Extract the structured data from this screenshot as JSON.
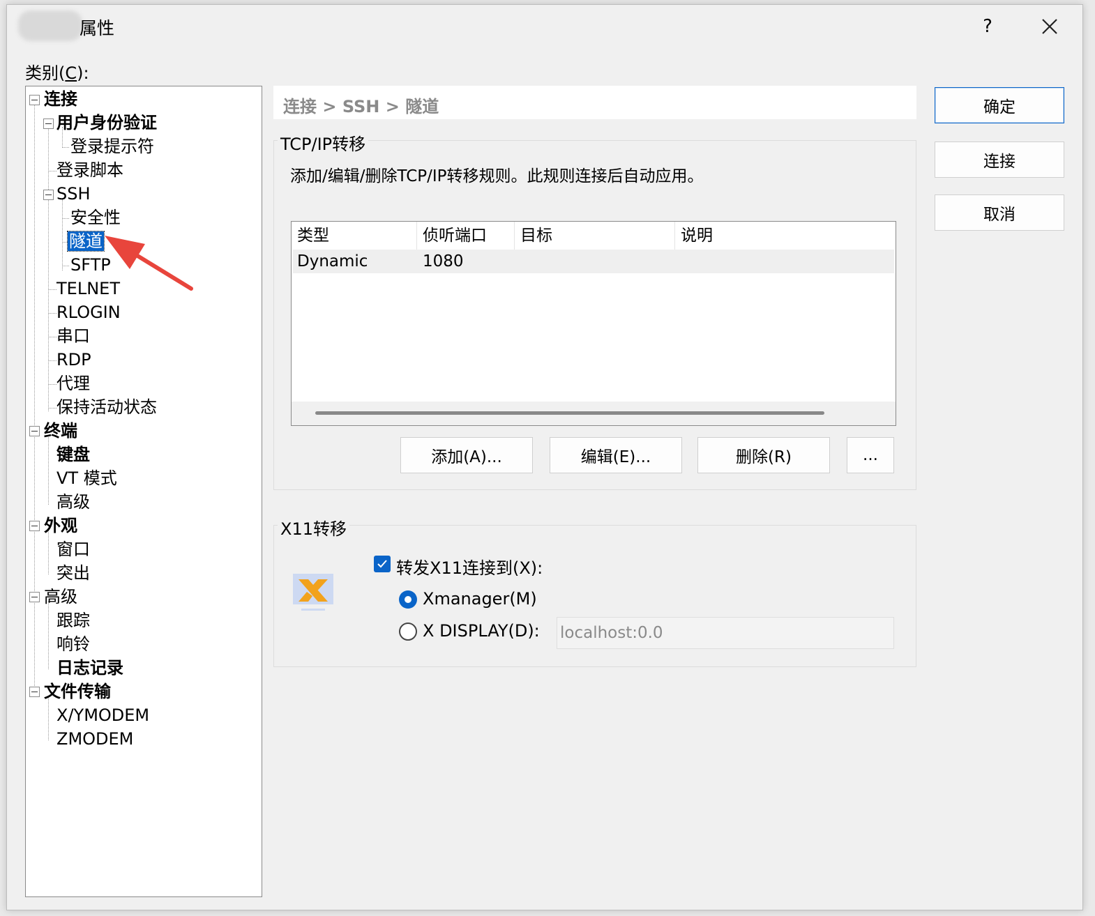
{
  "window": {
    "title": "属性",
    "help_label": "?",
    "close_label": "close"
  },
  "category": {
    "label": "类别(C):",
    "label_prefix": "类别(",
    "label_mnemonic": "C",
    "label_suffix": "):"
  },
  "tree": [
    {
      "label": "连接",
      "bold": true
    },
    {
      "label": "用户身份验证",
      "bold": true
    },
    {
      "label": "登录提示符",
      "bold": false
    },
    {
      "label": "登录脚本",
      "bold": false
    },
    {
      "label": "SSH",
      "bold": false
    },
    {
      "label": "安全性",
      "bold": false
    },
    {
      "label": "隧道",
      "bold": false,
      "selected": true
    },
    {
      "label": "SFTP",
      "bold": false
    },
    {
      "label": "TELNET",
      "bold": false
    },
    {
      "label": "RLOGIN",
      "bold": false
    },
    {
      "label": "串口",
      "bold": false
    },
    {
      "label": "RDP",
      "bold": false
    },
    {
      "label": "代理",
      "bold": false
    },
    {
      "label": "保持活动状态",
      "bold": false
    },
    {
      "label": "终端",
      "bold": true
    },
    {
      "label": "键盘",
      "bold": true
    },
    {
      "label": "VT 模式",
      "bold": false
    },
    {
      "label": "高级",
      "bold": false
    },
    {
      "label": "外观",
      "bold": true
    },
    {
      "label": "窗口",
      "bold": false
    },
    {
      "label": "突出",
      "bold": false
    },
    {
      "label": "高级",
      "bold": false
    },
    {
      "label": "跟踪",
      "bold": false
    },
    {
      "label": "响铃",
      "bold": false
    },
    {
      "label": "日志记录",
      "bold": true
    },
    {
      "label": "文件传输",
      "bold": true
    },
    {
      "label": "X/YMODEM",
      "bold": false
    },
    {
      "label": "ZMODEM",
      "bold": false
    }
  ],
  "breadcrumb": "连接 > SSH > 隧道",
  "tcp": {
    "group_title": "TCP/IP转移",
    "description": "添加/编辑/删除TCP/IP转移规则。此规则连接后自动应用。",
    "columns": [
      "类型",
      "侦听端口",
      "目标",
      "说明"
    ],
    "rows": [
      {
        "type": "Dynamic",
        "port": "1080",
        "target": "",
        "note": ""
      }
    ],
    "buttons": {
      "add": "添加(A)...",
      "edit": "编辑(E)...",
      "delete": "删除(R)",
      "more": "..."
    }
  },
  "x11": {
    "group_title": "X11转移",
    "forward_label": "转发X11连接到(X):",
    "forward_checked": true,
    "xmanager_label": "Xmanager(M)",
    "xmanager_selected": true,
    "xdisplay_label": "X DISPLAY(D):",
    "xdisplay_selected": false,
    "xdisplay_value": "localhost:0.0"
  },
  "actions": {
    "ok": "确定",
    "connect": "连接",
    "cancel": "取消"
  },
  "colors": {
    "accent": "#0a64c8",
    "annotation_arrow": "#e8453c"
  }
}
